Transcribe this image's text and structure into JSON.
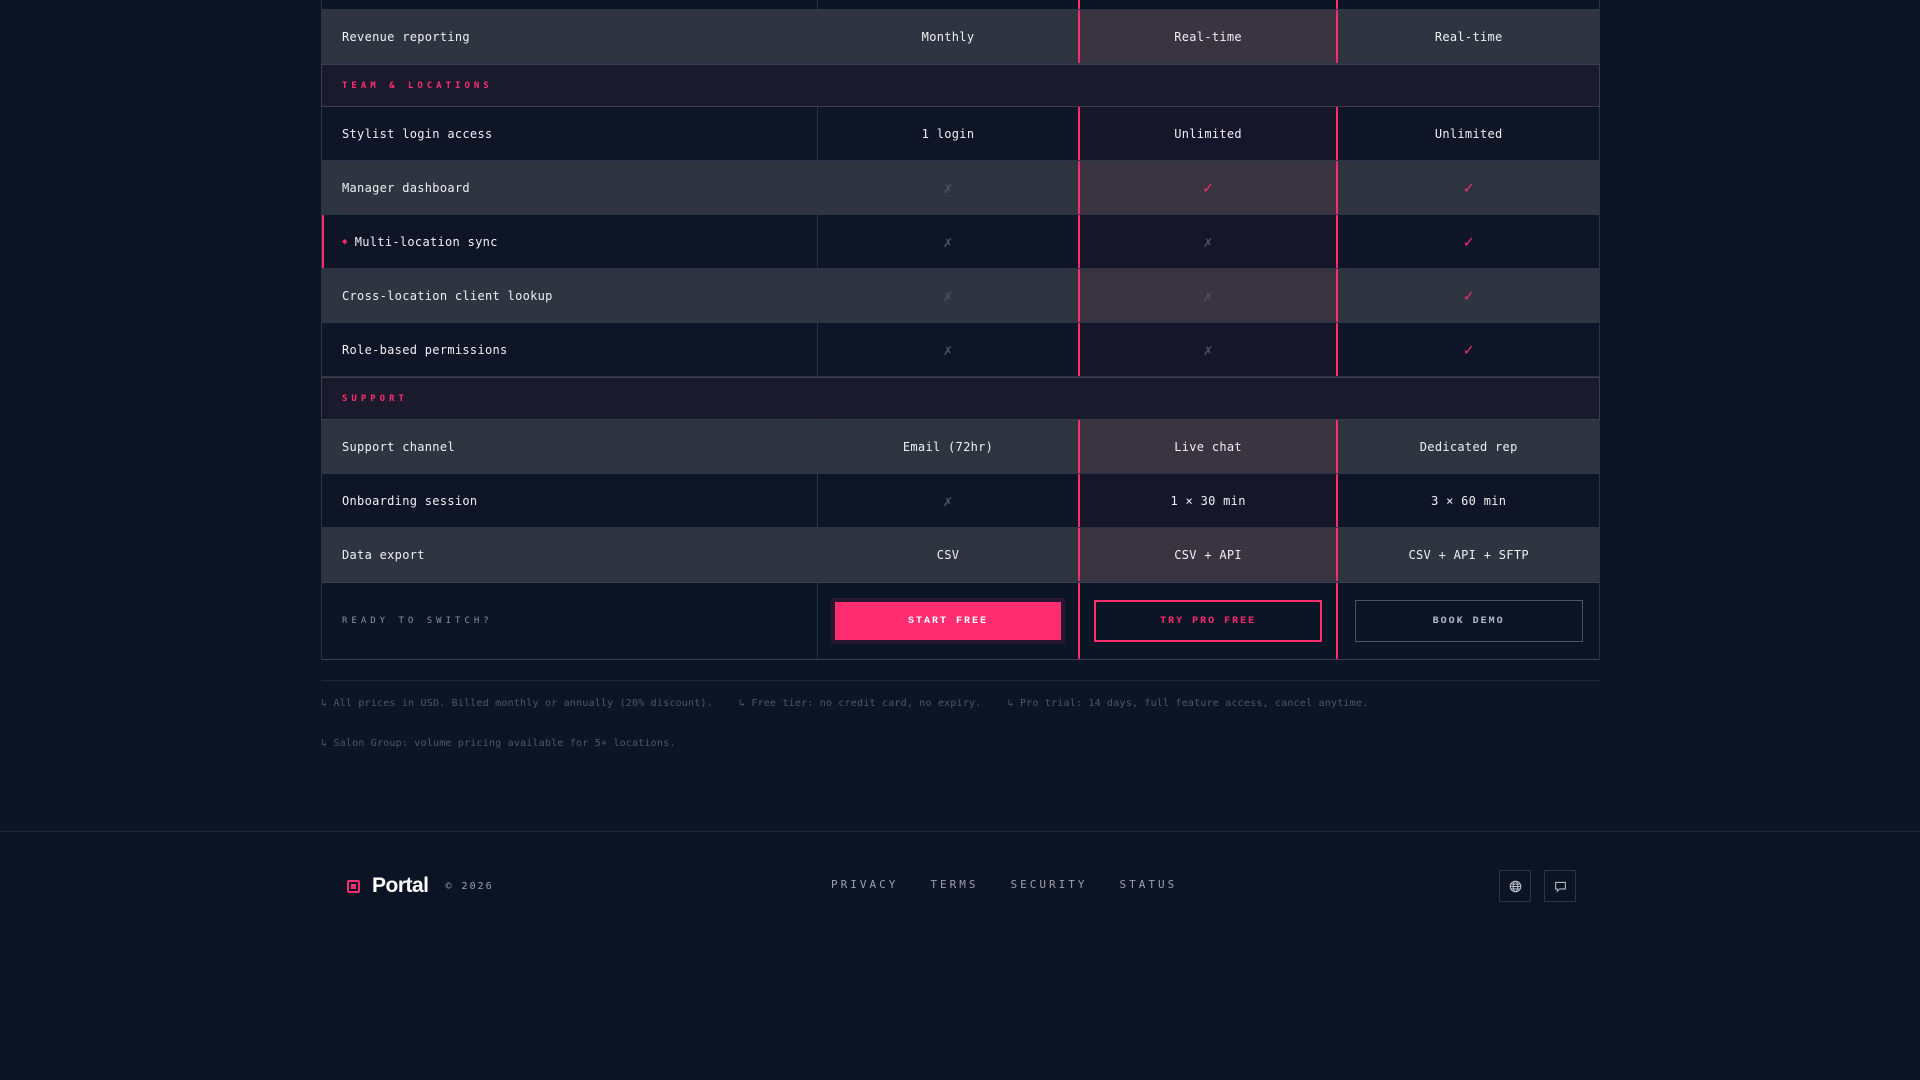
{
  "table": {
    "rows_top": [
      {
        "feature": "Revenue reporting",
        "values": [
          "Monthly",
          "Real-time",
          "Real-time"
        ],
        "style": "alt"
      }
    ],
    "sections": [
      {
        "title": "TEAM & LOCATIONS",
        "rows": [
          {
            "feature": "Stylist login access",
            "values": [
              "1 login",
              "Unlimited",
              "Unlimited"
            ]
          },
          {
            "feature": "Manager dashboard",
            "values": [
              "✗",
              "✓",
              "✓"
            ]
          },
          {
            "feature": "Multi-location sync",
            "marker": "◆",
            "values": [
              "✗",
              "✗",
              "✓"
            ]
          },
          {
            "feature": "Cross-location client lookup",
            "values": [
              "✗",
              "✗",
              "✓"
            ]
          },
          {
            "feature": "Role-based permissions",
            "values": [
              "✗",
              "✗",
              "✓"
            ]
          }
        ]
      },
      {
        "title": "SUPPORT",
        "rows": [
          {
            "feature": "Support channel",
            "values": [
              "Email (72hr)",
              "Live chat",
              "Dedicated rep"
            ]
          },
          {
            "feature": "Onboarding session",
            "values": [
              "✗",
              "1 × 30 min",
              "3 × 60 min"
            ]
          },
          {
            "feature": "Data export",
            "values": [
              "CSV",
              "CSV + API",
              "CSV + API + SFTP"
            ]
          }
        ]
      }
    ],
    "cta": {
      "label": "READY TO SWITCH?",
      "buttons": [
        "START FREE",
        "TRY PRO FREE",
        "BOOK DEMO"
      ]
    }
  },
  "notes": [
    [
      "↳ All prices in USD. Billed monthly or annually (20% discount).",
      "↳ Free tier: no credit card, no expiry.",
      "↳ Pro trial: 14 days, full feature access, cancel anytime."
    ],
    [
      "↳ Salon Group: volume pricing available for 5+ locations."
    ]
  ],
  "footer": {
    "brand": "Portal",
    "copyright": "© 2026",
    "links": [
      "PRIVACY",
      "TERMS",
      "SECURITY",
      "STATUS"
    ],
    "icons": [
      "globe-icon",
      "chat-icon"
    ]
  },
  "colors": {
    "accent": "#ff2d6f",
    "background": "#0b1526",
    "row_alt": "#2e3440"
  }
}
